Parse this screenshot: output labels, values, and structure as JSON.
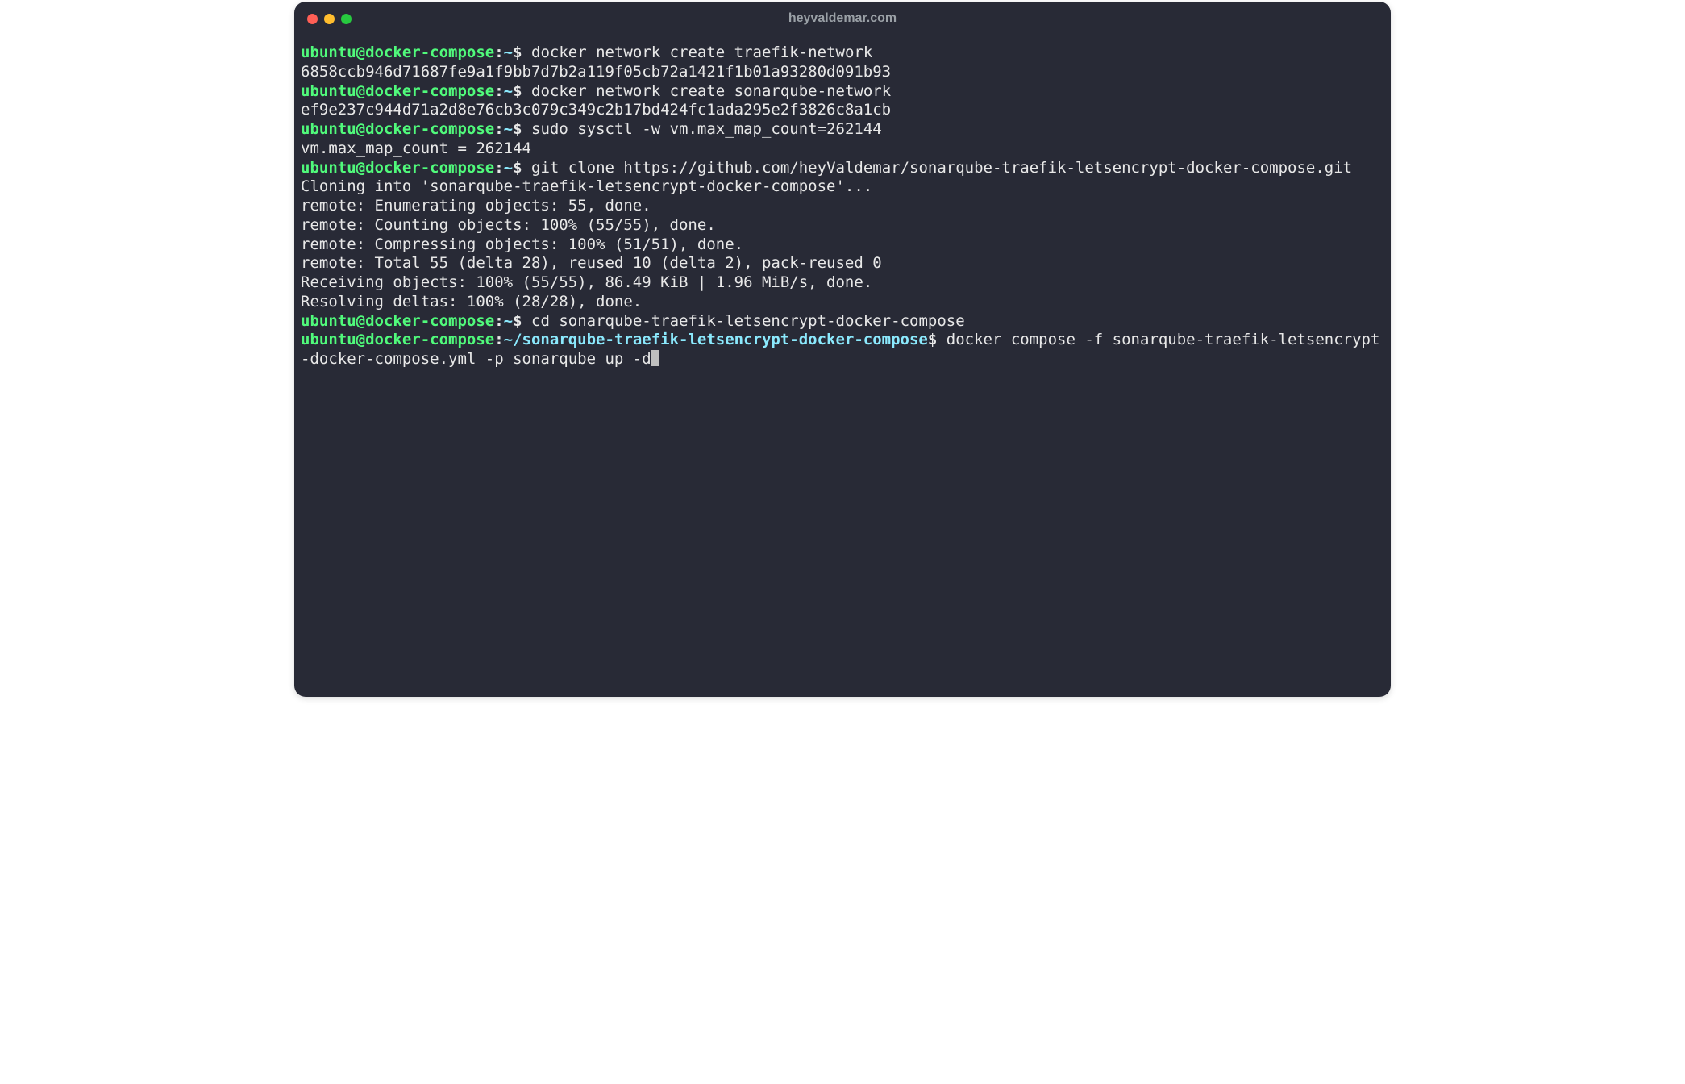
{
  "window": {
    "title": "heyvaldemar.com"
  },
  "prompt": {
    "user_host": "ubuntu@docker-compose",
    "sep": ":",
    "home_path": "~",
    "long_path": "~/sonarqube-traefik-letsencrypt-docker-compose",
    "dollar": "$"
  },
  "lines": {
    "cmd1": " docker network create traefik-network",
    "out1": "6858ccb946d71687fe9a1f9bb7d7b2a119f05cb72a1421f1b01a93280d091b93",
    "cmd2": " docker network create sonarqube-network",
    "out2": "ef9e237c944d71a2d8e76cb3c079c349c2b17bd424fc1ada295e2f3826c8a1cb",
    "cmd3": " sudo sysctl -w vm.max_map_count=262144",
    "out3": "vm.max_map_count = 262144",
    "cmd4": " git clone https://github.com/heyValdemar/sonarqube-traefik-letsencrypt-docker-compose.git",
    "out4a": "Cloning into 'sonarqube-traefik-letsencrypt-docker-compose'...",
    "out4b": "remote: Enumerating objects: 55, done.",
    "out4c": "remote: Counting objects: 100% (55/55), done.",
    "out4d": "remote: Compressing objects: 100% (51/51), done.",
    "out4e": "remote: Total 55 (delta 28), reused 10 (delta 2), pack-reused 0",
    "out4f": "Receiving objects: 100% (55/55), 86.49 KiB | 1.96 MiB/s, done.",
    "out4g": "Resolving deltas: 100% (28/28), done.",
    "cmd5": " cd sonarqube-traefik-letsencrypt-docker-compose",
    "cmd6": " docker compose -f sonarqube-traefik-letsencrypt-docker-compose.yml -p sonarqube up -d"
  }
}
